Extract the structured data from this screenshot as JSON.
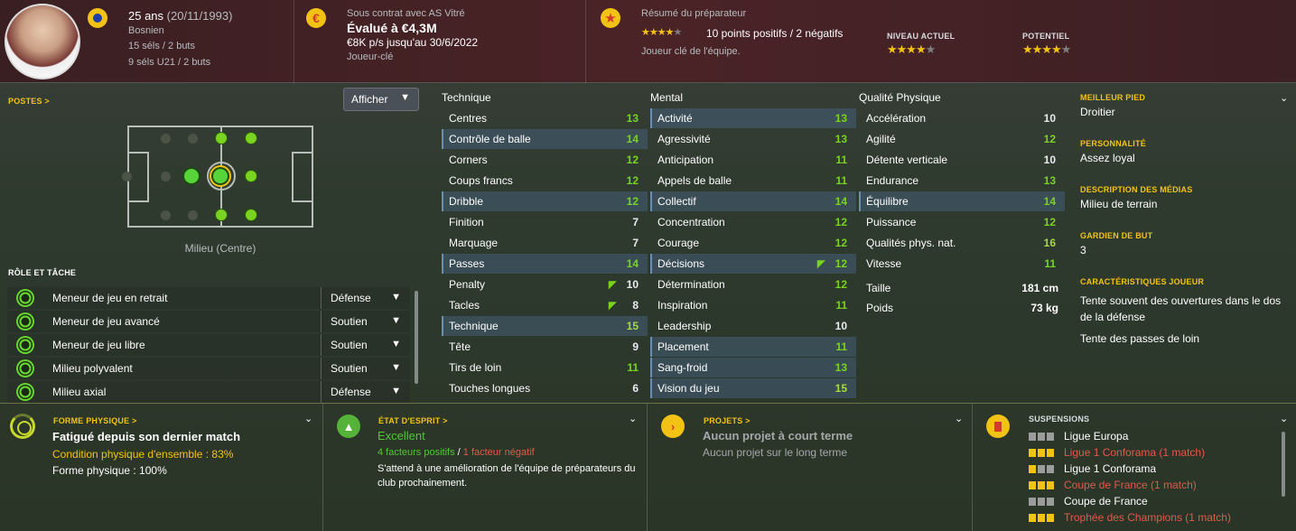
{
  "header": {
    "age": "25 ans",
    "dob": "(20/11/1993)",
    "nationality": "Bosnien",
    "caps": "15 séls / 2 buts",
    "u21_caps": "9 séls U21 / 2 buts",
    "contract": "Sous contrat avec AS Vitré",
    "value": "Évalué à €4,3M",
    "wage": "€8K p/s jusqu'au 30/6/2022",
    "squad_status": "Joueur-clé",
    "coach_summary_title": "Résumé du préparateur",
    "coach_points": "10 points positifs / 2 négatifs",
    "coach_key": "Joueur clé de l'équipe.",
    "current_level_label": "NIVEAU ACTUEL",
    "potential_label": "POTENTIEL",
    "summary_stars": 4,
    "current_level_stars": 4,
    "potential_stars": 4
  },
  "positions": {
    "label": "POSTES >",
    "display_button": "Afficher",
    "position_name": "Milieu (Centre)"
  },
  "roles": {
    "label": "RÔLE ET TÂCHE",
    "items": [
      {
        "name": "Meneur de jeu en retrait",
        "duty": "Défense"
      },
      {
        "name": "Meneur de jeu avancé",
        "duty": "Soutien"
      },
      {
        "name": "Meneur de jeu libre",
        "duty": "Soutien"
      },
      {
        "name": "Milieu polyvalent",
        "duty": "Soutien"
      },
      {
        "name": "Milieu axial",
        "duty": "Défense"
      }
    ]
  },
  "attributes": {
    "technical_title": "Technique",
    "mental_title": "Mental",
    "physical_title": "Qualité Physique",
    "technical": [
      {
        "name": "Centres",
        "value": "13",
        "hl": false
      },
      {
        "name": "Contrôle de balle",
        "value": "14",
        "hl": true
      },
      {
        "name": "Corners",
        "value": "12",
        "hl": false
      },
      {
        "name": "Coups francs",
        "value": "12",
        "hl": false
      },
      {
        "name": "Dribble",
        "value": "12",
        "hl": true
      },
      {
        "name": "Finition",
        "value": "7",
        "hl": false
      },
      {
        "name": "Marquage",
        "value": "7",
        "hl": false
      },
      {
        "name": "Passes",
        "value": "14",
        "hl": true
      },
      {
        "name": "Penalty",
        "value": "10",
        "hl": false,
        "arrow": true
      },
      {
        "name": "Tacles",
        "value": "8",
        "hl": false,
        "arrow": true
      },
      {
        "name": "Technique",
        "value": "15",
        "hl": true
      },
      {
        "name": "Tête",
        "value": "9",
        "hl": false
      },
      {
        "name": "Tirs de loin",
        "value": "11",
        "hl": false
      },
      {
        "name": "Touches longues",
        "value": "6",
        "hl": false
      }
    ],
    "mental": [
      {
        "name": "Activité",
        "value": "13",
        "hl": true
      },
      {
        "name": "Agressivité",
        "value": "13",
        "hl": false
      },
      {
        "name": "Anticipation",
        "value": "11",
        "hl": false
      },
      {
        "name": "Appels de balle",
        "value": "11",
        "hl": false
      },
      {
        "name": "Collectif",
        "value": "14",
        "hl": true
      },
      {
        "name": "Concentration",
        "value": "12",
        "hl": false
      },
      {
        "name": "Courage",
        "value": "12",
        "hl": false
      },
      {
        "name": "Décisions",
        "value": "12",
        "hl": true,
        "arrow": true
      },
      {
        "name": "Détermination",
        "value": "12",
        "hl": false
      },
      {
        "name": "Inspiration",
        "value": "11",
        "hl": false
      },
      {
        "name": "Leadership",
        "value": "10",
        "hl": false
      },
      {
        "name": "Placement",
        "value": "11",
        "hl": true
      },
      {
        "name": "Sang-froid",
        "value": "13",
        "hl": true
      },
      {
        "name": "Vision du jeu",
        "value": "15",
        "hl": true
      }
    ],
    "physical": [
      {
        "name": "Accélération",
        "value": "10",
        "hl": false
      },
      {
        "name": "Agilité",
        "value": "12",
        "hl": false
      },
      {
        "name": "Détente verticale",
        "value": "10",
        "hl": false
      },
      {
        "name": "Endurance",
        "value": "13",
        "hl": false
      },
      {
        "name": "Équilibre",
        "value": "14",
        "hl": true
      },
      {
        "name": "Puissance",
        "value": "12",
        "hl": false
      },
      {
        "name": "Qualités phys. nat.",
        "value": "16",
        "hl": false
      },
      {
        "name": "Vitesse",
        "value": "11",
        "hl": false
      }
    ],
    "height_label": "Taille",
    "height": "181 cm",
    "weight_label": "Poids",
    "weight": "73 kg"
  },
  "info": {
    "foot_label": "MEILLEUR PIED",
    "foot": "Droitier",
    "personality_label": "PERSONNALITÉ",
    "personality": "Assez loyal",
    "media_label": "DESCRIPTION DES MÉDIAS",
    "media": "Milieu de terrain",
    "gk_label": "GARDIEN DE BUT",
    "gk": "3",
    "traits_label": "CARACTÉRISTIQUES JOUEUR",
    "trait1": "Tente souvent des ouvertures dans le dos de la défense",
    "trait2": "Tente des passes de loin"
  },
  "bottom": {
    "form_label": "FORME PHYSIQUE >",
    "form_title": "Fatigué depuis son dernier match",
    "condition": "Condition physique d'ensemble : 83%",
    "fitness": "Forme physique : 100%",
    "morale_label": "ÉTAT D'ESPRIT >",
    "morale_value": "Excellent",
    "morale_positive": "4 facteurs positifs",
    "morale_sep": "/",
    "morale_negative": "1 facteur négatif",
    "morale_text": "S'attend à une amélioration de l'équipe de préparateurs du club prochainement.",
    "projects_label": "PROJETS >",
    "projects_short": "Aucun projet à court terme",
    "projects_long": "Aucun projet sur le long terme",
    "susp_label": "SUSPENSIONS",
    "suspensions": [
      {
        "name": "Ligue Europa",
        "boxes": [
          0,
          0,
          0
        ],
        "red": false
      },
      {
        "name": "Ligue 1 Conforama (1 match)",
        "boxes": [
          1,
          1,
          1
        ],
        "red": true
      },
      {
        "name": "Ligue 1 Conforama",
        "boxes": [
          1,
          0,
          0
        ],
        "red": false
      },
      {
        "name": "Coupe de France (1 match)",
        "boxes": [
          1,
          1,
          1
        ],
        "red": true
      },
      {
        "name": "Coupe de France",
        "boxes": [
          0,
          0,
          0
        ],
        "red": false
      },
      {
        "name": "Trophée des Champions (1 match)",
        "boxes": [
          1,
          1,
          1
        ],
        "red": true
      }
    ]
  },
  "colors": {
    "accent": "#f2c314",
    "positive": "#55c23a",
    "negative": "#e05a4a"
  }
}
